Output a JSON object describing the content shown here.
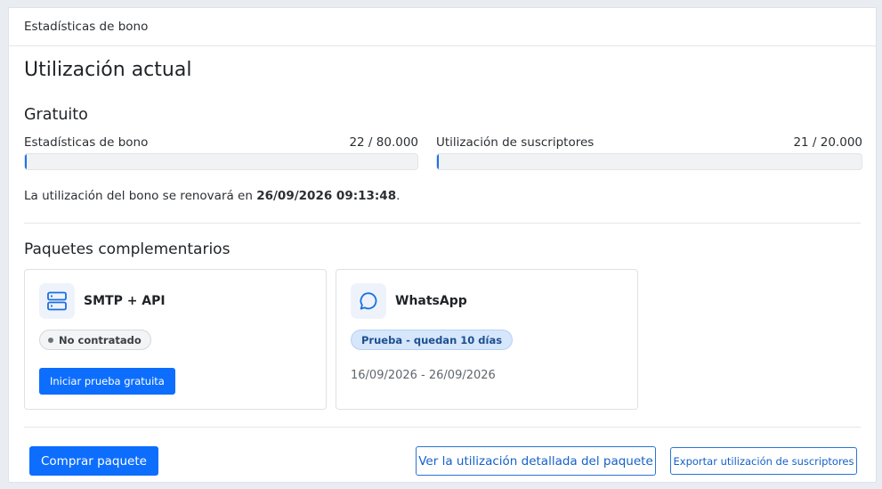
{
  "header": {
    "title": "Estadísticas de bono"
  },
  "main": {
    "title": "Utilización actual",
    "plan": "Gratuito",
    "usage": [
      {
        "label": "Estadísticas de bono",
        "value": "22 / 80.000",
        "fraction": 0.000275
      },
      {
        "label": "Utilización de suscriptores",
        "value": "21 / 20.000",
        "fraction": 0.00105
      }
    ],
    "renewal": {
      "prefix": "La utilización del bono se renovará en ",
      "datetime": "26/09/2026 09:13:48",
      "suffix": "."
    },
    "addons_title": "Paquetes complementarios",
    "packages": [
      {
        "icon": "server-icon",
        "title": "SMTP + API",
        "status": "No contratado",
        "action": "Iniciar prueba gratuita"
      },
      {
        "icon": "chat-bubble-icon",
        "title": "WhatsApp",
        "status": "Prueba - quedan 10 días",
        "dates": "16/09/2026 - 26/09/2026"
      }
    ],
    "footer": {
      "buy": "Comprar paquete",
      "detail": "Ver la utilización detallada del paquete",
      "export": "Exportar utilización de suscriptores"
    }
  },
  "colors": {
    "accent": "#0d6efd",
    "bar_fill": "#1a73e8",
    "badge_blue_bg": "#d6e6fb",
    "badge_blue_text": "#1d4f91"
  }
}
